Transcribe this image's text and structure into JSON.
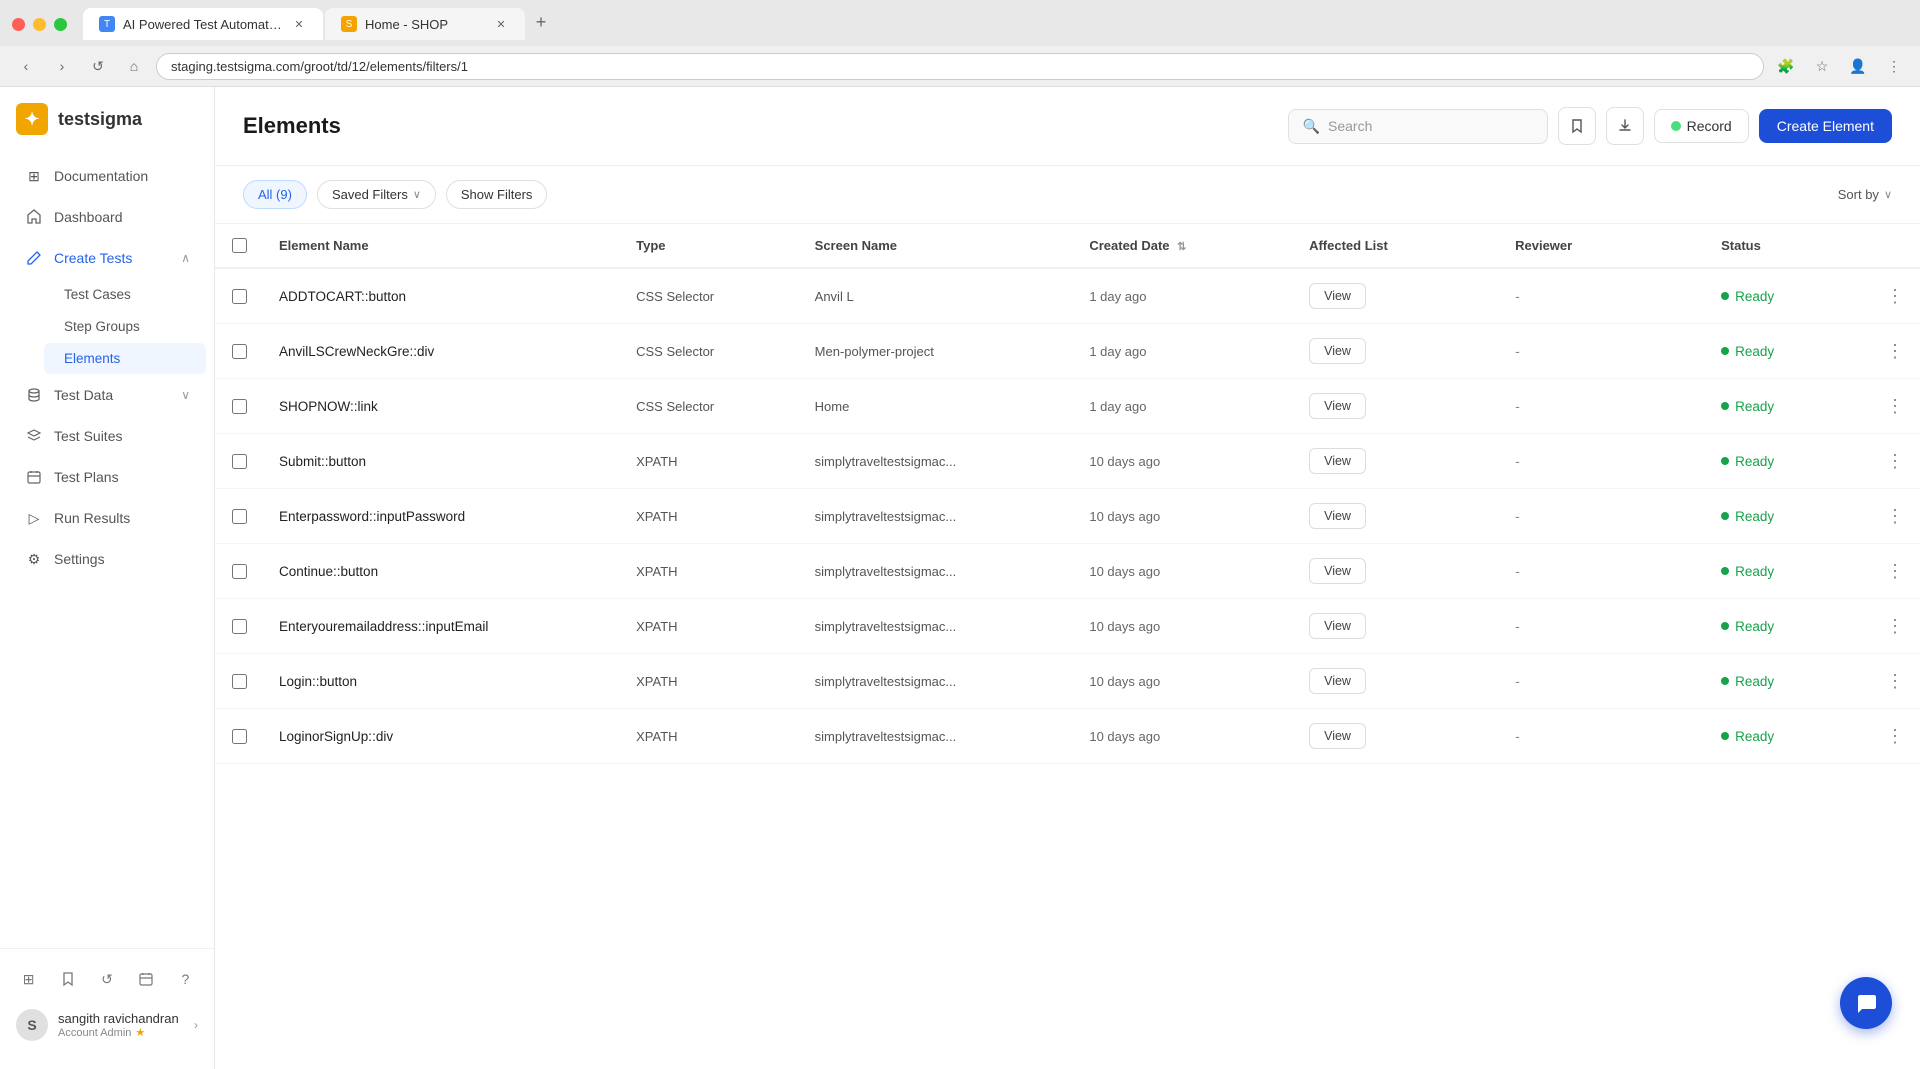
{
  "browser": {
    "tabs": [
      {
        "id": "tab1",
        "favicon_color": "#4285f4",
        "title": "AI Powered Test Automation P...",
        "active": true
      },
      {
        "id": "tab2",
        "favicon_color": "#f4a300",
        "title": "Home - SHOP",
        "active": false
      }
    ],
    "address": "staging.testsigma.com/groot/td/12/elements/filters/1"
  },
  "sidebar": {
    "logo_text": "testsigma",
    "items": [
      {
        "id": "documentation",
        "label": "Documentation",
        "icon": "grid"
      },
      {
        "id": "dashboard",
        "label": "Dashboard",
        "icon": "home"
      },
      {
        "id": "create-tests",
        "label": "Create Tests",
        "icon": "pencil",
        "expanded": true
      },
      {
        "id": "test-data",
        "label": "Test Data",
        "icon": "database",
        "has_chevron": true
      },
      {
        "id": "test-suites",
        "label": "Test Suites",
        "icon": "layers"
      },
      {
        "id": "test-plans",
        "label": "Test Plans",
        "icon": "calendar"
      },
      {
        "id": "run-results",
        "label": "Run Results",
        "icon": "play"
      },
      {
        "id": "settings",
        "label": "Settings",
        "icon": "gear"
      }
    ],
    "sub_items": [
      {
        "id": "test-cases",
        "label": "Test Cases"
      },
      {
        "id": "step-groups",
        "label": "Step Groups"
      },
      {
        "id": "elements",
        "label": "Elements",
        "active": true
      }
    ],
    "footer_icons": [
      {
        "id": "grid-view",
        "icon": "⊞"
      },
      {
        "id": "bookmark",
        "icon": "🔖"
      },
      {
        "id": "refresh",
        "icon": "↺"
      },
      {
        "id": "calendar-footer",
        "icon": "📅"
      },
      {
        "id": "help",
        "icon": "?"
      }
    ],
    "user": {
      "initials": "S",
      "name": "sangith ravichandran",
      "role": "Account Admin"
    }
  },
  "header": {
    "title": "Elements",
    "search_placeholder": "Search",
    "record_label": "Record",
    "create_label": "Create Element"
  },
  "filters": {
    "all_label": "All (9)",
    "saved_filters_label": "Saved Filters",
    "show_filters_label": "Show Filters",
    "sort_by_label": "Sort by"
  },
  "table": {
    "columns": [
      "Element Name",
      "Type",
      "Screen Name",
      "Created Date",
      "Affected List",
      "Reviewer",
      "Status"
    ],
    "rows": [
      {
        "name": "ADDTOCART::button",
        "type": "CSS Selector",
        "screen": "Anvil L",
        "created": "1 day ago",
        "reviewer": "-",
        "status": "Ready"
      },
      {
        "name": "AnvilLSCrewNeckGre::div",
        "type": "CSS Selector",
        "screen": "Men-polymer-project",
        "created": "1 day ago",
        "reviewer": "-",
        "status": "Ready"
      },
      {
        "name": "SHOPNOW::link",
        "type": "CSS Selector",
        "screen": "Home",
        "created": "1 day ago",
        "reviewer": "-",
        "status": "Ready"
      },
      {
        "name": "Submit::button",
        "type": "XPATH",
        "screen": "simplytraveltestsigmac...",
        "created": "10 days ago",
        "reviewer": "-",
        "status": "Ready"
      },
      {
        "name": "Enterpassword::inputPassword",
        "type": "XPATH",
        "screen": "simplytraveltestsigmac...",
        "created": "10 days ago",
        "reviewer": "-",
        "status": "Ready"
      },
      {
        "name": "Continue::button",
        "type": "XPATH",
        "screen": "simplytraveltestsigmac...",
        "created": "10 days ago",
        "reviewer": "-",
        "status": "Ready"
      },
      {
        "name": "Enteryouremailaddress::inputEmail",
        "type": "XPATH",
        "screen": "simplytraveltestsigmac...",
        "created": "10 days ago",
        "reviewer": "-",
        "status": "Ready"
      },
      {
        "name": "Login::button",
        "type": "XPATH",
        "screen": "simplytraveltestsigmac...",
        "created": "10 days ago",
        "reviewer": "-",
        "status": "Ready"
      },
      {
        "name": "LoginorSignUp::div",
        "type": "XPATH",
        "screen": "simplytraveltestsigmac...",
        "created": "10 days ago",
        "reviewer": "-",
        "status": "Ready"
      }
    ],
    "view_label": "View"
  },
  "chat_icon": "💬",
  "colors": {
    "accent": "#1d4ed8",
    "status_ready": "#16a34a",
    "record_dot": "#4ade80"
  }
}
